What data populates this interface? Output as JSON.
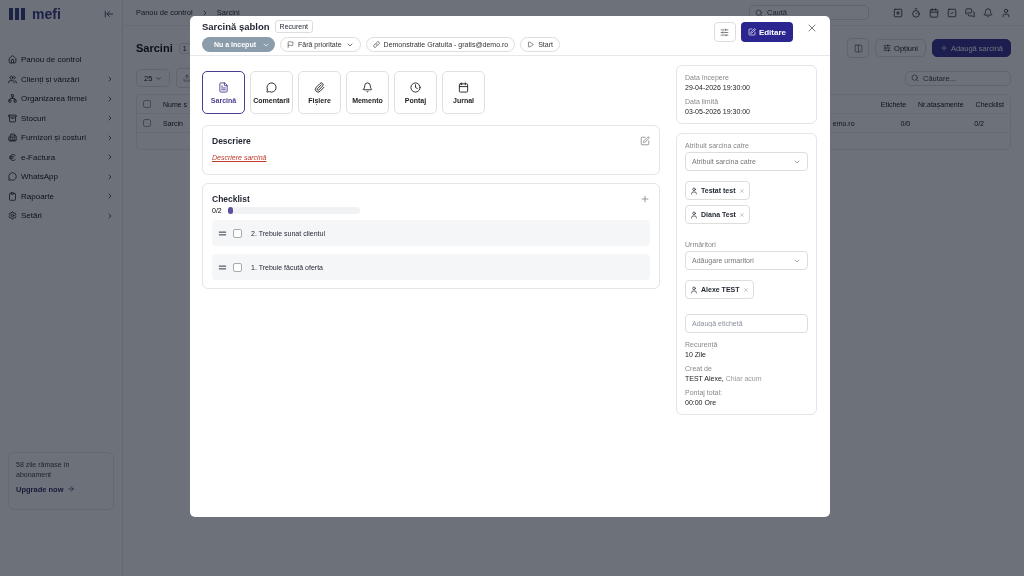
{
  "app": {
    "logo": "mefi"
  },
  "sidebar": {
    "items": [
      {
        "label": "Panou de control",
        "has_children": false
      },
      {
        "label": "Clienți și vânzări",
        "has_children": true
      },
      {
        "label": "Organizarea firmei",
        "has_children": true
      },
      {
        "label": "Stocuri",
        "has_children": true
      },
      {
        "label": "Furnizori și costuri",
        "has_children": true
      },
      {
        "label": "e-Factura",
        "has_children": true
      },
      {
        "label": "WhatsApp",
        "has_children": true
      },
      {
        "label": "Rapoarte",
        "has_children": true
      },
      {
        "label": "Setări",
        "has_children": true
      }
    ],
    "promo": {
      "text": "58 zile rămase în abonament",
      "link": "Upgrade now"
    }
  },
  "topbar": {
    "breadcrumb": [
      "Panou de control",
      "Sarcini"
    ],
    "search_placeholder": "Caută"
  },
  "page": {
    "title": "Sarcini",
    "count": "1",
    "options_button": "Opțiuni",
    "add_button": "Adaugă sarcină",
    "page_size": "25",
    "search_placeholder": "Căutare...",
    "table": {
      "left_columns": [
        "Nume s"
      ],
      "right_columns": [
        "Etichete",
        "Nr.atașamente",
        "Checklist"
      ],
      "header_checked": false,
      "row": {
        "checked": false,
        "name": "Sarcin",
        "email": "emo.ro",
        "attachments": "0/0",
        "checklist": "0/2"
      }
    }
  },
  "modal": {
    "title": "Sarcină șablon",
    "badge": "Recurent",
    "status": "Nu a început",
    "priority": "Fără prioritate",
    "link": "Demonstratie Gratuita - gratis@demo.ro",
    "start": "Start",
    "edit_button": "Editare",
    "tabs": [
      {
        "label": "Sarcină",
        "selected": true
      },
      {
        "label": "Comentarii",
        "selected": false
      },
      {
        "label": "Fișiere",
        "selected": false
      },
      {
        "label": "Memento",
        "selected": false
      },
      {
        "label": "Pontaj",
        "selected": false
      },
      {
        "label": "Jurnal",
        "selected": false
      }
    ],
    "description": {
      "title": "Descriere",
      "text": "Descriere sarcină"
    },
    "checklist": {
      "title": "Checklist",
      "progress": "0/2",
      "level": 0,
      "items": [
        {
          "label": "2. Trebuie sunat clientul",
          "checked": false
        },
        {
          "label": "1. Trebuie făcută oferta",
          "checked": false
        }
      ]
    },
    "dates": [
      {
        "label": "Data începere",
        "value": "29-04-2026 19:30:00"
      },
      {
        "label": "Data limită",
        "value": "03-05-2026 19:30:00"
      }
    ],
    "assign": {
      "label": "Atribuit sarcina catre",
      "placeholder": "Atribuit sarcina catre",
      "people": [
        "Testat test",
        "Diana Test"
      ]
    },
    "followers": {
      "label": "Urmăritori",
      "placeholder": "Adăugare urmaritori",
      "people": [
        "Alexe TEST"
      ]
    },
    "tag_placeholder": "Adaugă etichetă",
    "recurrence": {
      "label": "Recurență",
      "value": "10 Zile"
    },
    "created": {
      "label": "Creat de",
      "author": "TEST Alexe,",
      "time": "Chiar acum"
    },
    "time_total": {
      "label": "Pontaj total:",
      "value": "00:00 Ore"
    }
  }
}
